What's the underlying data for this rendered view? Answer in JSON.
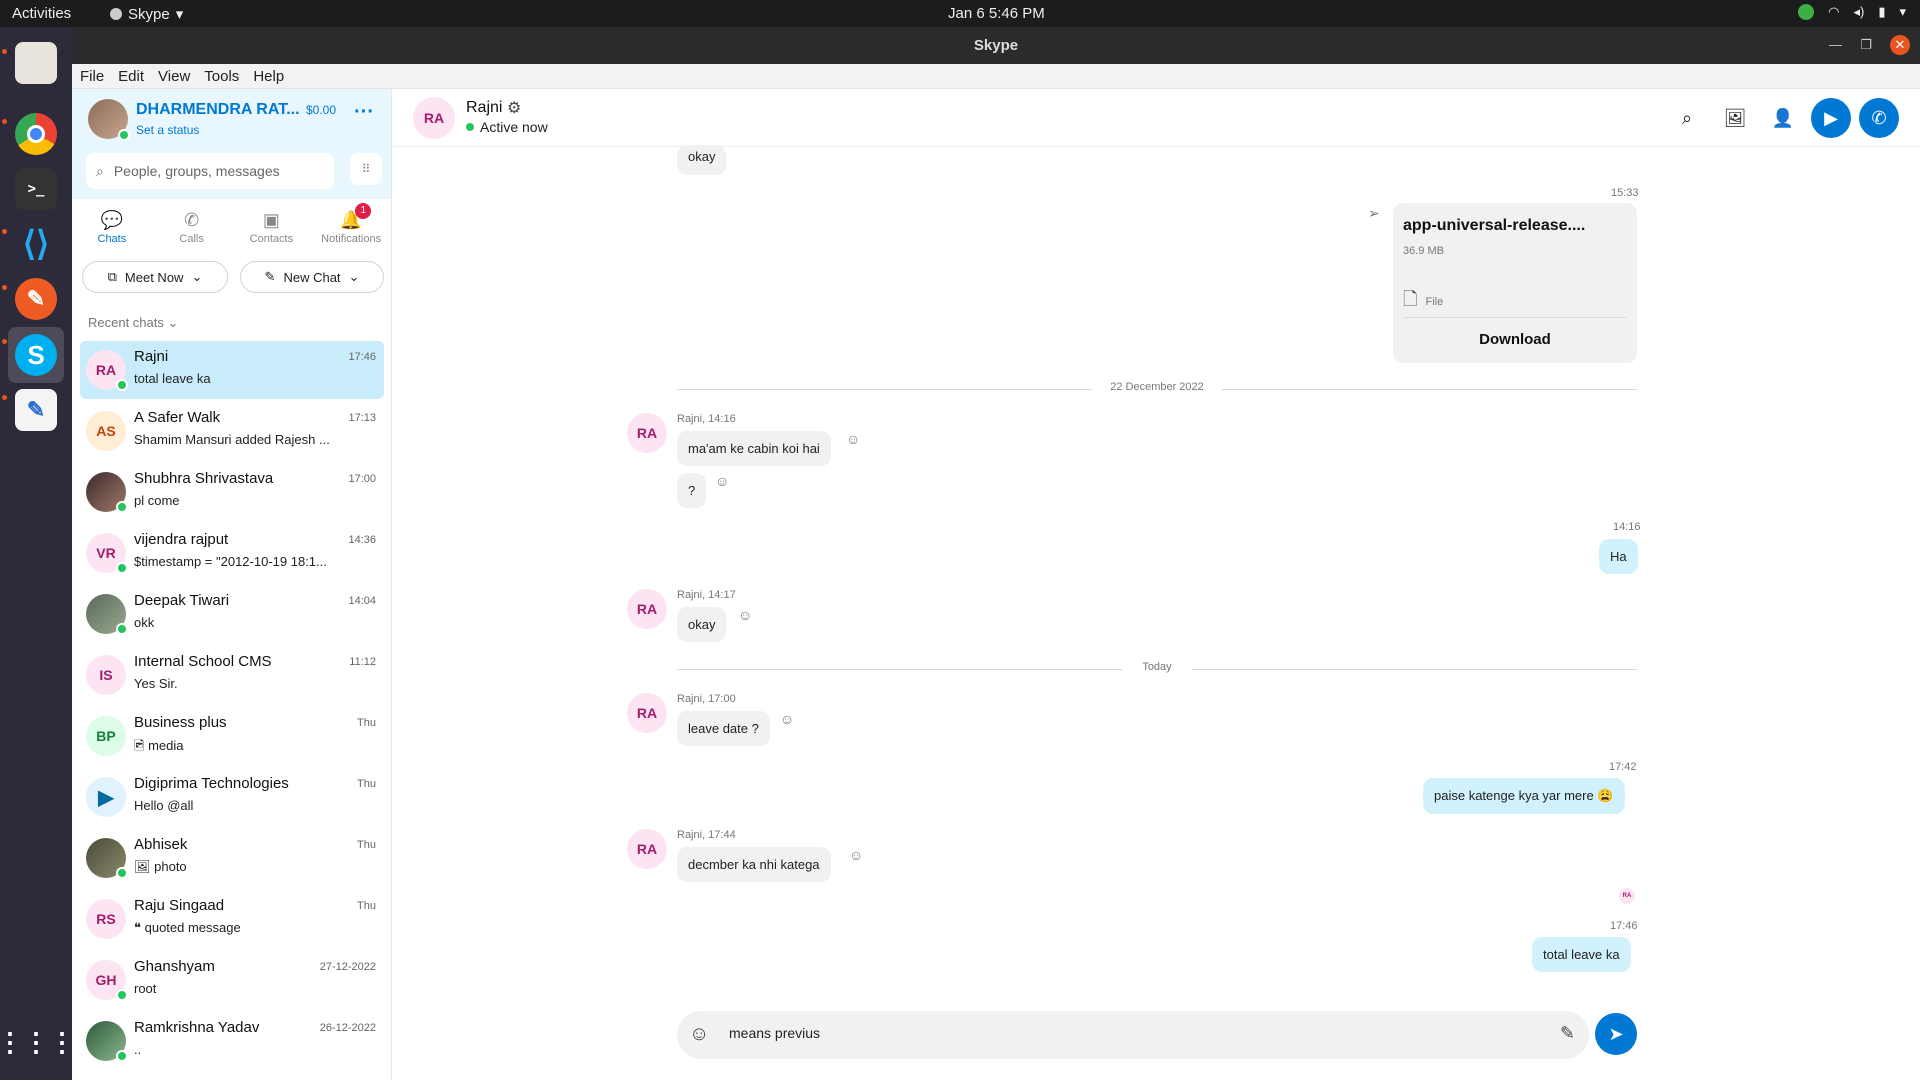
{
  "system": {
    "activities": "Activities",
    "app_menu": "Skype",
    "clock": "Jan 6  5:46 PM"
  },
  "window": {
    "title": "Skype"
  },
  "menu": [
    "File",
    "Edit",
    "View",
    "Tools",
    "Help"
  ],
  "profile": {
    "name": "DHARMENDRA RAT...",
    "credit": "$0.00",
    "status": "Set a status"
  },
  "search": {
    "placeholder": "People, groups, messages"
  },
  "tabs": [
    {
      "label": "Chats",
      "icon": "chat-icon"
    },
    {
      "label": "Calls",
      "icon": "phone-icon"
    },
    {
      "label": "Contacts",
      "icon": "contacts-icon"
    },
    {
      "label": "Notifications",
      "icon": "bell-icon",
      "badge": "1"
    }
  ],
  "actions": {
    "meet_now": "Meet Now",
    "new_chat": "New Chat"
  },
  "recent_header": "Recent chats",
  "chats": [
    {
      "initials": "RA",
      "name": "Rajni",
      "time": "17:46",
      "preview": "total leave ka"
    },
    {
      "initials": "AS",
      "name": "A Safer Walk",
      "time": "17:13",
      "preview": "Shamim Mansuri added Rajesh ..."
    },
    {
      "initials": "",
      "name": "Shubhra Shrivastava",
      "time": "17:00",
      "preview": "pl come"
    },
    {
      "initials": "VR",
      "name": "vijendra rajput",
      "time": "14:36",
      "preview": "$timestamp = \"2012-10-19 18:1..."
    },
    {
      "initials": "",
      "name": "Deepak Tiwari",
      "time": "14:04",
      "preview": "okk"
    },
    {
      "initials": "IS",
      "name": "Internal School CMS",
      "time": "11:12",
      "preview": "Yes Sir."
    },
    {
      "initials": "BP",
      "name": "Business plus",
      "time": "Thu",
      "preview": "media"
    },
    {
      "initials": "",
      "name": "Digiprima Technologies",
      "time": "Thu",
      "preview": "Hello @all"
    },
    {
      "initials": "",
      "name": "Abhisek",
      "time": "Thu",
      "preview": "photo"
    },
    {
      "initials": "RS",
      "name": "Raju Singaad",
      "time": "Thu",
      "preview": "quoted message"
    },
    {
      "initials": "GH",
      "name": "Ghanshyam",
      "time": "27-12-2022",
      "preview": "root"
    },
    {
      "initials": "",
      "name": "Ramkrishna Yadav",
      "time": "26-12-2022",
      "preview": ".."
    }
  ],
  "conversation": {
    "initials": "RA",
    "name": "Rajni",
    "status": "Active now",
    "messages": {
      "top_okay": "okay",
      "file_time": "15:33",
      "file_name": "app-universal-release....",
      "file_size": "36.9 MB",
      "file_type": "File",
      "file_download": "Download",
      "divider1": "22 December 2022",
      "m1_meta": "Rajni, 14:16",
      "m1_text": "ma'am ke cabin koi hai",
      "m2_text": "?",
      "o1_time": "14:16",
      "o1_text": "Ha",
      "m3_meta": "Rajni, 14:17",
      "m3_text": "okay",
      "divider2": "Today",
      "m4_meta": "Rajni, 17:00",
      "m4_text": "leave date ?",
      "o2_time": "17:42",
      "o2_text": "paise katenge kya yar mere 😩",
      "m5_meta": "Rajni, 17:44",
      "m5_text": "decmber ka nhi katega",
      "seen_initials": "RA",
      "o3_time": "17:46",
      "o3_text": "total leave ka"
    },
    "composer_value": "means previus"
  }
}
